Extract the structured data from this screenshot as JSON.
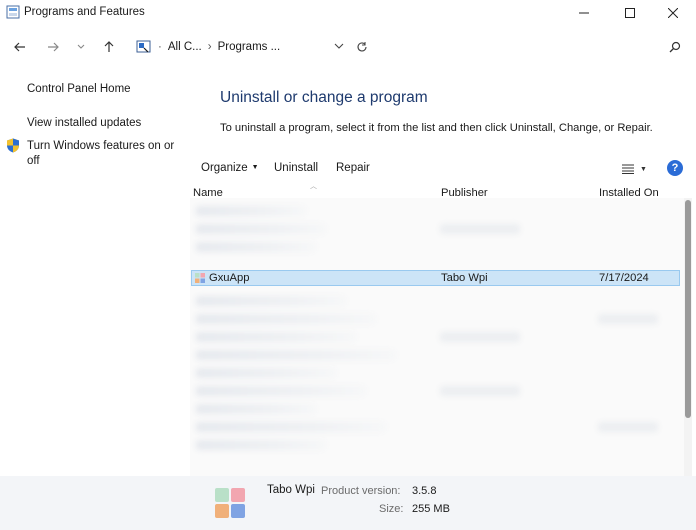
{
  "window": {
    "title": "Programs and Features",
    "minimize_icon": "minimize-icon",
    "maximize_icon": "maximize-icon",
    "close_icon": "close-icon"
  },
  "addressbar": {
    "crumb_root": "All C...",
    "crumb_current": "Programs ...",
    "icons": [
      "back-arrow-icon",
      "forward-arrow-icon",
      "recent-locations-icon",
      "up-arrow-icon",
      "control-panel-icon",
      "refresh-icon",
      "search-icon"
    ]
  },
  "sidebar": {
    "home": "Control Panel Home",
    "updates": "View installed updates",
    "features": "Turn Windows features on or off"
  },
  "main": {
    "heading": "Uninstall or change a program",
    "instructions": "To uninstall a program, select it from the list and then click Uninstall, Change, or Repair."
  },
  "toolbar": {
    "organize": "Organize",
    "uninstall": "Uninstall",
    "repair": "Repair"
  },
  "columns": {
    "name": "Name",
    "publisher": "Publisher",
    "installed_on": "Installed On"
  },
  "selected_program": {
    "name": "GxuApp",
    "publisher": "Tabo Wpi",
    "installed_on": "7/17/2024"
  },
  "details": {
    "publisher": "Tabo Wpi",
    "version_label": "Product version:",
    "version": "3.5.8",
    "size_label": "Size:",
    "size": "255 MB"
  },
  "colors": {
    "heading": "#1e3a6e",
    "selection": "#cce4f7",
    "selection_border": "#99c9ef",
    "help_button": "#2b6cd6",
    "details_bg": "#f3f5f8"
  }
}
